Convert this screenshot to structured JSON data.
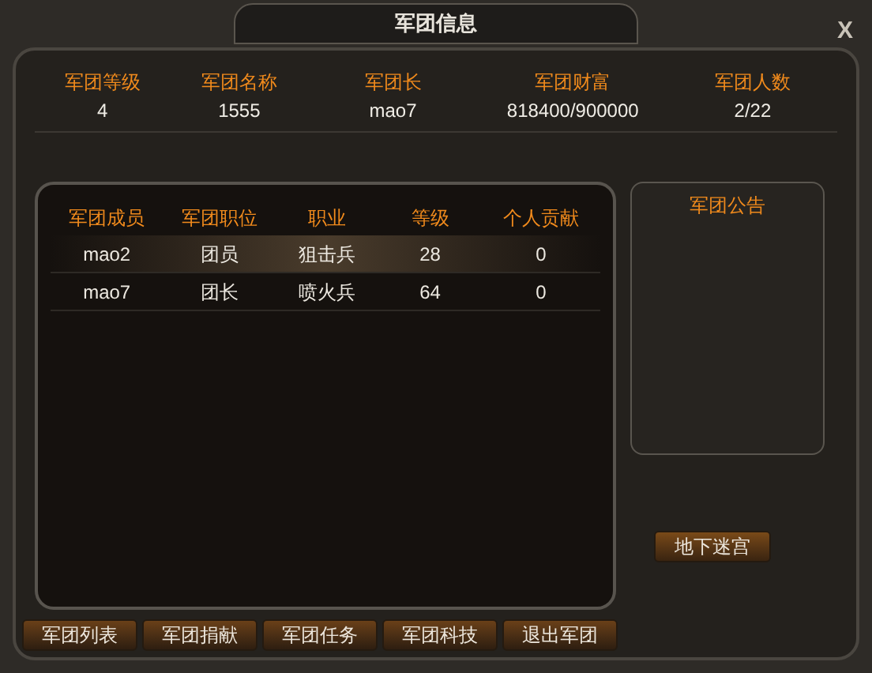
{
  "window": {
    "title": "军团信息",
    "close": "X"
  },
  "summary": [
    {
      "label": "军团等级",
      "value": "4"
    },
    {
      "label": "军团名称",
      "value": "1555"
    },
    {
      "label": "军团长",
      "value": "mao7"
    },
    {
      "label": "军团财富",
      "value": "818400/900000"
    },
    {
      "label": "军团人数",
      "value": "2/22"
    }
  ],
  "members": {
    "columns": [
      "军团成员",
      "军团职位",
      "职业",
      "等级",
      "个人贡献"
    ],
    "rows": [
      {
        "cells": [
          "mao2",
          "团员",
          "狙击兵",
          "28",
          "0"
        ],
        "selected": true
      },
      {
        "cells": [
          "mao7",
          "团长",
          "喷火兵",
          "64",
          "0"
        ],
        "selected": false
      }
    ]
  },
  "notice": {
    "title": "军团公告"
  },
  "dungeon_button": "地下迷宫",
  "buttons": [
    "军团列表",
    "军团捐献",
    "军团任务",
    "军团科技",
    "退出军团"
  ]
}
